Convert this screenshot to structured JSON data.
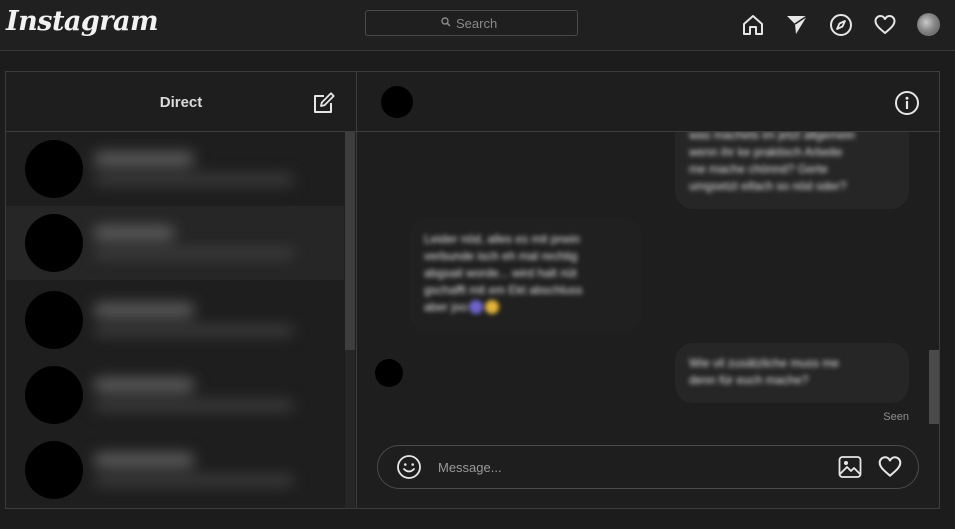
{
  "app": {
    "logo_text": "Instagram"
  },
  "search": {
    "placeholder": "Search"
  },
  "nav": {
    "icons": [
      "home-icon",
      "direct-icon",
      "explore-icon",
      "activity-icon",
      "profile-avatar"
    ]
  },
  "inbox": {
    "title": "Direct",
    "compose_icon": "new-message-icon",
    "thread_count": 5
  },
  "conversation": {
    "info_icon": "info-icon",
    "messages": [
      {
        "direction": "sent",
        "text": "was machets im jetzt allgemein\nwenn ihr ke praktisch Arbeite\nme mache chönnd? Gerte\numgsetzt eifach so nöd oder?"
      },
      {
        "direction": "received",
        "text": "Leider nöd, alles es mit pnein\nverbunde isch eh mal rechtig\nabgsait worde... wird halt nüt\ngschafft mit em Ekt abschluss\naber joo"
      },
      {
        "direction": "sent",
        "text": "Wie vil zusätzliche muss me\ndenn für euch mache?"
      }
    ],
    "seen_label": "Seen"
  },
  "composer": {
    "placeholder": "Message...",
    "icons": [
      "emoji-icon",
      "image-icon",
      "heart-icon"
    ]
  },
  "colors": {
    "background": "#1c1c1c",
    "panel": "#1e1e1e",
    "bubble": "#262626",
    "border": "#3d3d3d"
  }
}
